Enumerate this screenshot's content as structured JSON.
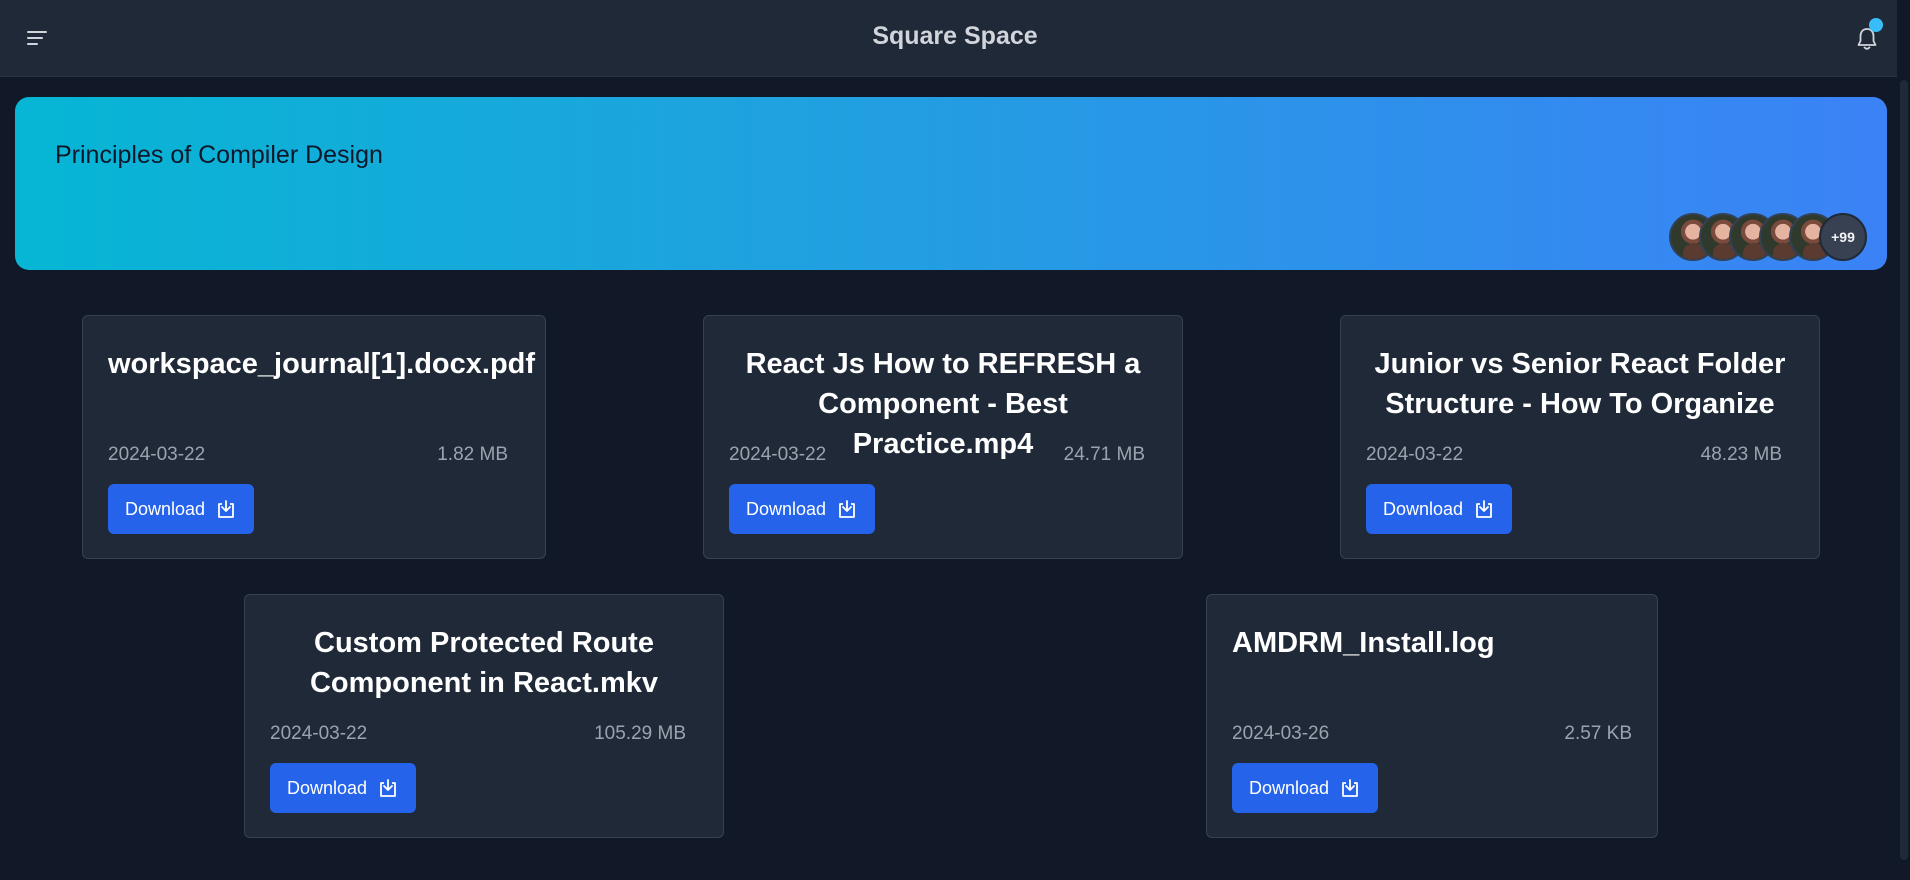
{
  "header": {
    "title": "Square Space",
    "menu_icon": "hamburger-menu-icon",
    "notification_icon": "bell-icon",
    "notification_dot_color": "#38bdf8"
  },
  "banner": {
    "title": "Principles of Compiler Design",
    "members_extra": "+99",
    "gradient_from": "#06b6d4",
    "gradient_to": "#3b82f6"
  },
  "files": [
    {
      "name": "workspace_journal[1].docx.pdf",
      "date": "2024-03-22",
      "size": "1.82 MB",
      "download_label": "Download"
    },
    {
      "name": "React Js How to REFRESH a Component - Best Practice.mp4",
      "date": "2024-03-22",
      "size": "24.71 MB",
      "download_label": "Download"
    },
    {
      "name": "Junior vs Senior React Folder Structure - How To Organize",
      "date": "2024-03-22",
      "size": "48.23 MB",
      "download_label": "Download"
    },
    {
      "name": "Custom Protected Route Component in React.mkv",
      "date": "2024-03-22",
      "size": "105.29 MB",
      "download_label": "Download"
    },
    {
      "name": "AMDRM_Install.log",
      "date": "2024-03-26",
      "size": "2.57 KB",
      "download_label": "Download"
    }
  ],
  "colors": {
    "background": "#111827",
    "card": "#1f2937",
    "button": "#2563eb"
  }
}
